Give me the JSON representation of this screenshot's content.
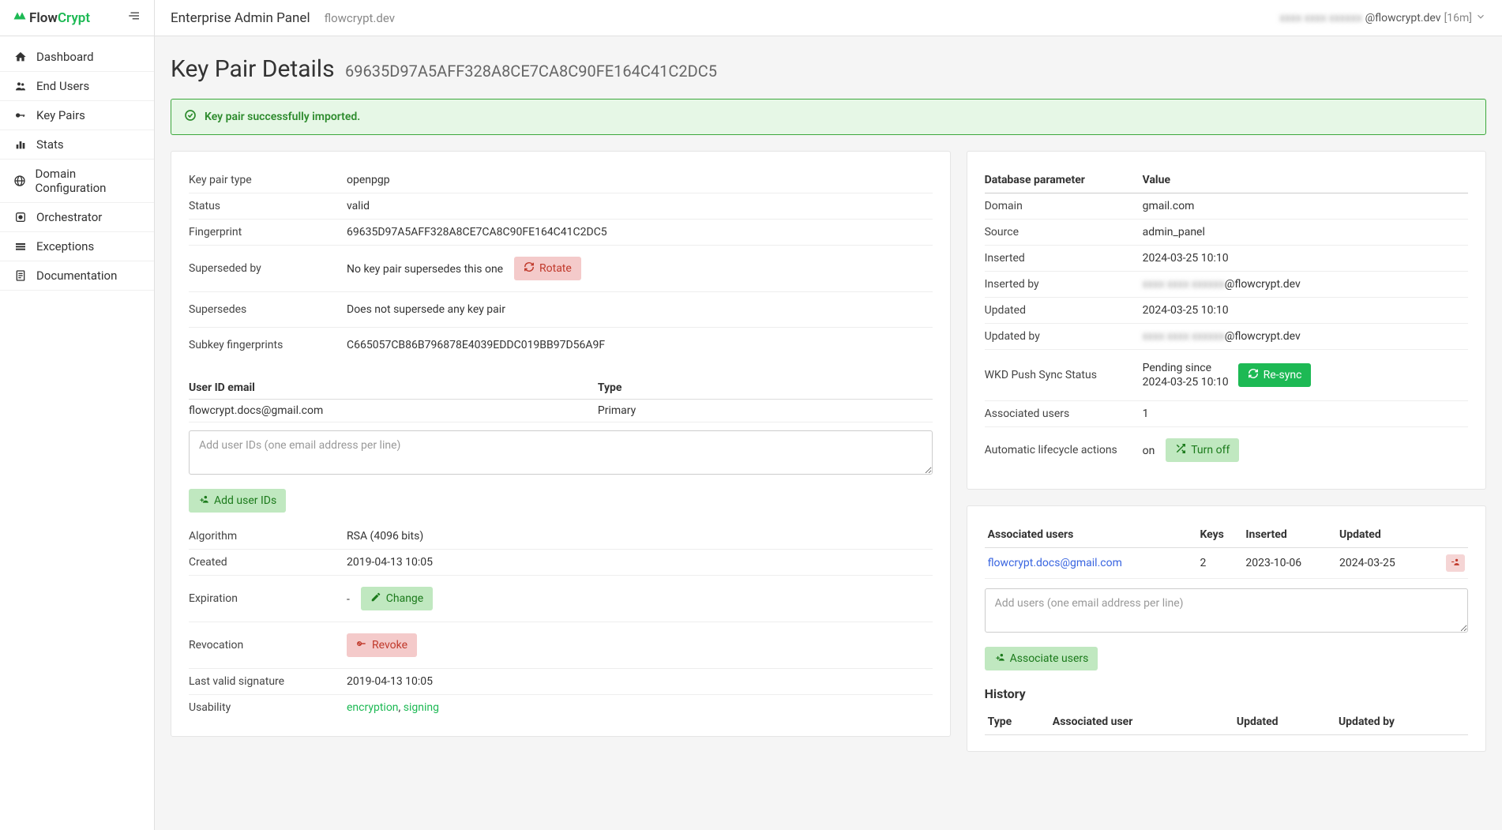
{
  "logo": {
    "flow": "Flow",
    "crypt": "Crypt"
  },
  "sidebar": {
    "items": [
      {
        "label": "Dashboard"
      },
      {
        "label": "End Users"
      },
      {
        "label": "Key Pairs"
      },
      {
        "label": "Stats"
      },
      {
        "label": "Domain Configuration"
      },
      {
        "label": "Orchestrator"
      },
      {
        "label": "Exceptions"
      },
      {
        "label": "Documentation"
      }
    ]
  },
  "topbar": {
    "title": "Enterprise Admin Panel",
    "domain": "flowcrypt.dev",
    "user_hidden": "xxxx xxxx xxxxxx",
    "user_suffix": "@flowcrypt.dev",
    "ttl": "[16m]"
  },
  "page": {
    "title": "Key Pair Details",
    "fingerprint_suffix": "69635D97A5AFF328A8CE7CA8C90FE164C41C2DC5"
  },
  "alert": {
    "text": "Key pair successfully imported."
  },
  "details": {
    "key_pair_type": {
      "k": "Key pair type",
      "v": "openpgp"
    },
    "status": {
      "k": "Status",
      "v": "valid"
    },
    "fingerprint": {
      "k": "Fingerprint",
      "v": "69635D97A5AFF328A8CE7CA8C90FE164C41C2DC5"
    },
    "superseded_by": {
      "k": "Superseded by",
      "v": "No key pair supersedes this one",
      "btn": "Rotate"
    },
    "supersedes": {
      "k": "Supersedes",
      "v": "Does not supersede any key pair"
    },
    "subkey": {
      "k": "Subkey fingerprints",
      "v": "C665057CB86B796878E4039EDDC019BB97D56A9F"
    },
    "userid_headers": {
      "email": "User ID email",
      "type": "Type"
    },
    "userid_row": {
      "email": "flowcrypt.docs@gmail.com",
      "type": "Primary"
    },
    "add_userids_placeholder": "Add user IDs (one email address per line)",
    "add_userids_btn": "Add user IDs",
    "algorithm": {
      "k": "Algorithm",
      "v": "RSA (4096 bits)"
    },
    "created": {
      "k": "Created",
      "v": "2019-04-13 10:05"
    },
    "expiration": {
      "k": "Expiration",
      "v": "-",
      "btn": "Change"
    },
    "revocation": {
      "k": "Revocation",
      "btn": "Revoke"
    },
    "last_valid": {
      "k": "Last valid signature",
      "v": "2019-04-13 10:05"
    },
    "usability": {
      "k": "Usability",
      "v1": "encryption",
      "sep": ", ",
      "v2": "signing"
    }
  },
  "db": {
    "header": {
      "param": "Database parameter",
      "value": "Value"
    },
    "domain": {
      "k": "Domain",
      "v": "gmail.com"
    },
    "source": {
      "k": "Source",
      "v": "admin_panel"
    },
    "inserted": {
      "k": "Inserted",
      "v": "2024-03-25 10:10"
    },
    "inserted_by": {
      "k": "Inserted by",
      "v_hidden": "xxxx xxxx xxxxxx",
      "suffix": "@flowcrypt.dev"
    },
    "updated": {
      "k": "Updated",
      "v": "2024-03-25 10:10"
    },
    "updated_by": {
      "k": "Updated by",
      "v_hidden": "xxxx xxxx xxxxxx",
      "suffix": "@flowcrypt.dev"
    },
    "wkd": {
      "k": "WKD Push Sync Status",
      "v1": "Pending since",
      "v2": "2024-03-25 10:10",
      "btn": "Re-sync"
    },
    "assoc_users": {
      "k": "Associated users",
      "v": "1"
    },
    "auto": {
      "k": "Automatic lifecycle actions",
      "v": "on",
      "btn": "Turn off"
    }
  },
  "assoc": {
    "headers": {
      "user": "Associated users",
      "keys": "Keys",
      "inserted": "Inserted",
      "updated": "Updated"
    },
    "row": {
      "user": "flowcrypt.docs@gmail.com",
      "keys": "2",
      "inserted": "2023-10-06",
      "updated": "2024-03-25"
    },
    "add_placeholder": "Add users (one email address per line)",
    "add_btn": "Associate users"
  },
  "history": {
    "title": "History",
    "headers": {
      "type": "Type",
      "user": "Associated user",
      "updated": "Updated",
      "updated_by": "Updated by"
    }
  }
}
